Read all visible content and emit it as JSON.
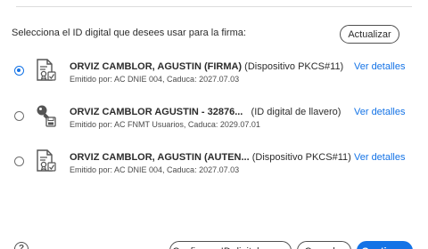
{
  "prompt": "Selecciona el ID digital que desees usar para la firma:",
  "refresh_label": "Actualizar",
  "details_label": "Ver detalles",
  "certificates": [
    {
      "name": "ORVIZ CAMBLOR, AGUSTIN (FIRMA)",
      "type": " (Dispositivo PKCS#11)",
      "issuer": "Emitido por: AC DNIE 004, Caduca: 2027.07.03",
      "icon": "certificate-icon",
      "selected": true
    },
    {
      "name": "ORVIZ CAMBLOR AGUSTIN - 32876...",
      "type": "   (ID digital de llavero)",
      "issuer": "Emitido por: AC FNMT Usuarios, Caduca: 2029.07.01",
      "icon": "key-icon",
      "selected": false
    },
    {
      "name": "ORVIZ CAMBLOR, AGUSTIN (AUTEN...",
      "type": " (Dispositivo PKCS#11)",
      "issuer": "Emitido por: AC DNIE 004, Caduca: 2027.07.03",
      "icon": "certificate-icon",
      "selected": false
    }
  ],
  "footer": {
    "help": "?",
    "configure_label": "Configurar ID digital nuevo",
    "cancel_label": "Cancelar",
    "continue_label": "Continuar"
  },
  "colors": {
    "accent": "#1473e6",
    "text": "#2c2c2c",
    "border": "#505050"
  }
}
